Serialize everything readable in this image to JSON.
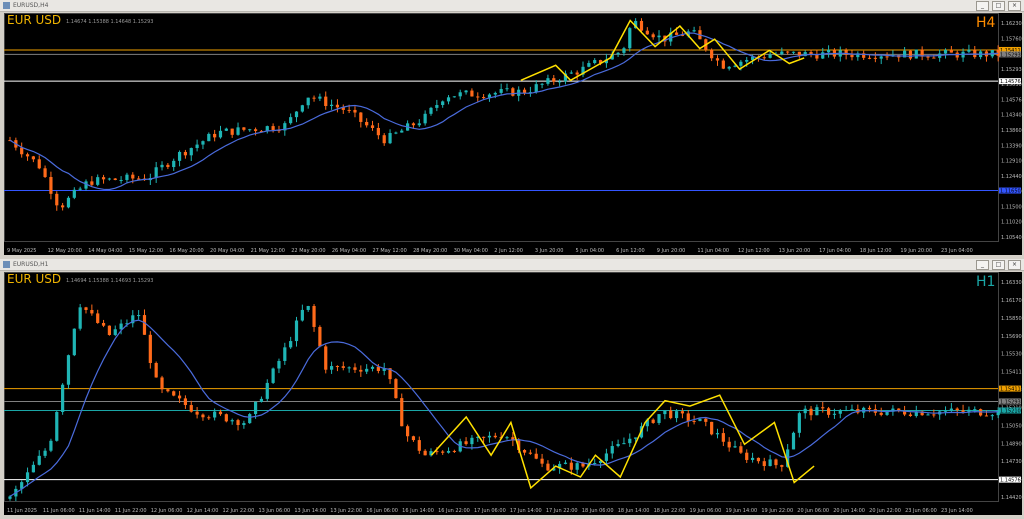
{
  "windows": [
    {
      "id": "h4",
      "title": "EURUSD,H4",
      "symbol_label": "EUR USD",
      "ohlc_text": "1.14674 1.15388 1.14648 1.15293",
      "timeframe": "H4",
      "timeframe_color": "#ff8c00",
      "price_axis_labels": [
        "1.16230",
        "1.15760",
        "1.15411",
        "1.15293",
        "1.15030",
        "1.14576",
        "1.14340",
        "1.13860",
        "1.13390",
        "1.12910",
        "1.12440",
        "1.11970",
        "1.11500",
        "1.11020",
        "1.10540"
      ],
      "time_labels": [
        "9 May 2025",
        "12 May 20:00",
        "14 May 04:00",
        "15 May 12:00",
        "16 May 20:00",
        "20 May 04:00",
        "21 May 12:00",
        "22 May 20:00",
        "26 May 04:00",
        "27 May 12:00",
        "28 May 20:00",
        "30 May 04:00",
        "2 Jun 12:00",
        "3 Jun 20:00",
        "5 Jun 04:00",
        "6 Jun 12:00",
        "9 Jun 20:00",
        "11 Jun 04:00",
        "12 Jun 12:00",
        "13 Jun 20:00",
        "17 Jun 04:00",
        "18 Jun 12:00",
        "19 Jun 20:00",
        "23 Jun 04:00"
      ],
      "levels": [
        {
          "price": 1.15411,
          "color": "#f0a000",
          "label": "1.15411"
        },
        {
          "price": 1.15293,
          "color": "#808080",
          "label": "1.15293"
        },
        {
          "price": 1.14576,
          "color": "#ffffff",
          "label": "1.14576"
        },
        {
          "price": 1.1165,
          "color": "#3355ff",
          "label": "1.11650"
        }
      ],
      "price_range": [
        1.103,
        1.164
      ]
    },
    {
      "id": "h1",
      "title": "EURUSD,H1",
      "symbol_label": "EUR USD",
      "ohlc_text": "1.14694 1.15388 1.14693 1.15293",
      "timeframe": "H1",
      "timeframe_color": "#1aa6a6",
      "price_axis_labels": [
        "1.16330",
        "1.16170",
        "1.15850",
        "1.15690",
        "1.15530",
        "1.15411",
        "1.15293",
        "1.15210",
        "1.15050",
        "1.14890",
        "1.14730",
        "1.14576",
        "1.14420"
      ],
      "time_labels": [
        "11 Jun 2025",
        "11 Jun 06:00",
        "11 Jun 14:00",
        "11 Jun 22:00",
        "12 Jun 06:00",
        "12 Jun 14:00",
        "12 Jun 22:00",
        "13 Jun 06:00",
        "13 Jun 14:00",
        "13 Jun 22:00",
        "16 Jun 06:00",
        "16 Jun 14:00",
        "16 Jun 22:00",
        "17 Jun 06:00",
        "17 Jun 14:00",
        "17 Jun 22:00",
        "18 Jun 06:00",
        "18 Jun 14:00",
        "18 Jun 22:00",
        "19 Jun 06:00",
        "19 Jun 14:00",
        "19 Jun 22:00",
        "20 Jun 06:00",
        "20 Jun 14:00",
        "20 Jun 22:00",
        "23 Jun 06:00",
        "23 Jun 14:00"
      ],
      "levels": [
        {
          "price": 1.15411,
          "color": "#f0a000",
          "label": "1.15411"
        },
        {
          "price": 1.15293,
          "color": "#808080",
          "label": "1.15293"
        },
        {
          "price": 1.1521,
          "color": "#1aa6a6",
          "label": "1.15210"
        },
        {
          "price": 1.14576,
          "color": "#ffffff",
          "label": "1.14576"
        }
      ],
      "price_range": [
        1.1438,
        1.1648
      ]
    }
  ],
  "colors": {
    "bull": "#1fb5b5",
    "bear": "#ff6a1a",
    "ma": "#4a6bdc",
    "zigzag": "#ffe000",
    "background": "#000000"
  },
  "window_buttons": [
    "_",
    "□",
    "×"
  ]
}
